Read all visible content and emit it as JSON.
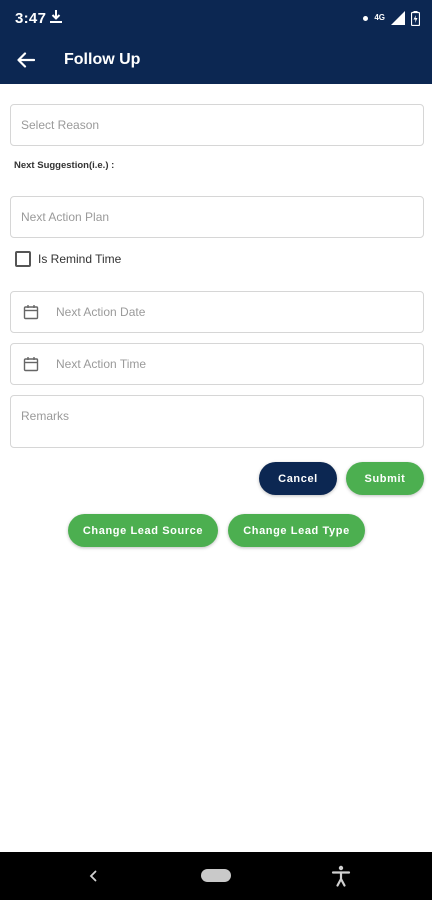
{
  "status_bar": {
    "time": "3:47",
    "network": "4G"
  },
  "app_bar": {
    "title": "Follow Up"
  },
  "form": {
    "reason_placeholder": "Select Reason",
    "suggestion_label": "Next Suggestion(i.e.) :",
    "action_plan_placeholder": "Next Action Plan",
    "remind_time_label": "Is Remind Time",
    "remind_time_checked": false,
    "action_date_placeholder": "Next Action Date",
    "action_time_placeholder": "Next Action Time",
    "remarks_placeholder": "Remarks"
  },
  "buttons": {
    "cancel": "Cancel",
    "submit": "Submit",
    "change_lead_source": "Change Lead Source",
    "change_lead_type": "Change Lead Type"
  },
  "colors": {
    "primary": "#0c2752",
    "accent": "#4caf50"
  },
  "icons": {
    "back": "arrow-left",
    "calendar": "calendar",
    "nav_back": "chevron-left",
    "accessibility": "accessibility"
  }
}
